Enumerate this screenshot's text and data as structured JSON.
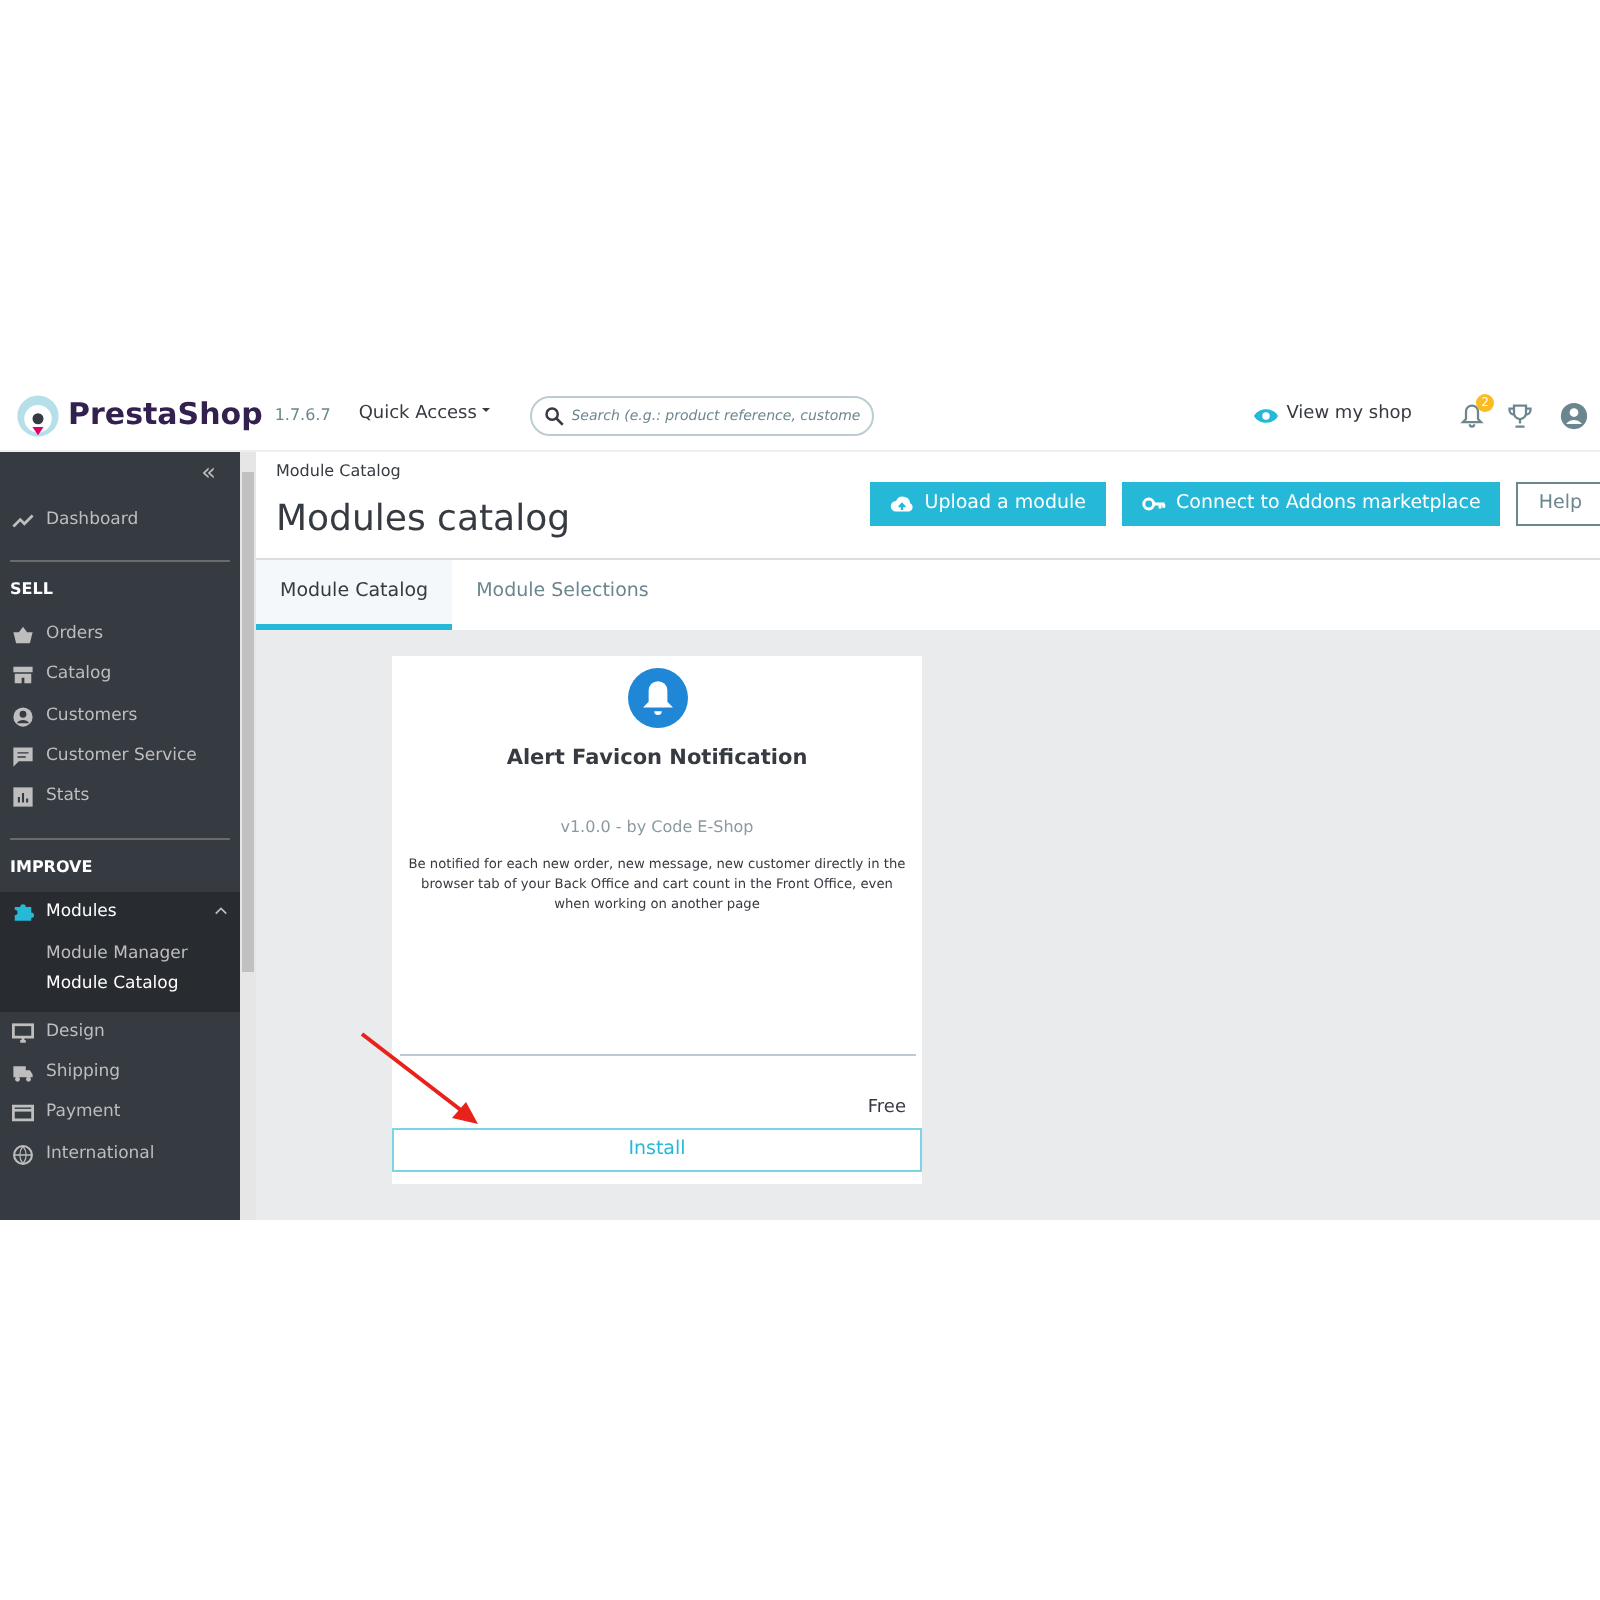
{
  "header": {
    "logo": "PrestaShop",
    "version": "1.7.6.7",
    "quick_access": "Quick Access",
    "search": {
      "placeholder": "Search (e.g.: product reference, custome"
    },
    "view_shop": "View my shop",
    "notifications": "2"
  },
  "sidebar": {
    "collapse": "«",
    "items": [
      {
        "kind": "item",
        "label": "Dashboard",
        "expanded": false
      },
      {
        "kind": "section",
        "label": "SELL"
      },
      {
        "kind": "item",
        "label": "Orders",
        "expanded": false
      },
      {
        "kind": "item",
        "label": "Catalog",
        "expanded": false
      },
      {
        "kind": "item",
        "label": "Customers",
        "expanded": false
      },
      {
        "kind": "item",
        "label": "Customer Service",
        "expanded": false
      },
      {
        "kind": "item",
        "label": "Stats",
        "expanded": false
      },
      {
        "kind": "section",
        "label": "IMPROVE"
      },
      {
        "kind": "item",
        "label": "Modules",
        "expanded": true,
        "children": [
          {
            "label": "Module Manager",
            "selected": false
          },
          {
            "label": "Module Catalog",
            "selected": true
          }
        ]
      },
      {
        "kind": "item",
        "label": "Design",
        "expanded": false
      },
      {
        "kind": "item",
        "label": "Shipping",
        "expanded": false
      },
      {
        "kind": "item",
        "label": "Payment",
        "expanded": false
      },
      {
        "kind": "item",
        "label": "International",
        "expanded": false
      }
    ]
  },
  "page": {
    "breadcrumb": "Module Catalog",
    "title": "Modules catalog",
    "buttons": [
      {
        "label": "Upload a module",
        "kind": "primary"
      },
      {
        "label": "Connect to Addons marketplace",
        "kind": "primary"
      },
      {
        "label": "Help",
        "kind": "outline"
      }
    ]
  },
  "tabs": [
    {
      "label": "Module Catalog",
      "selected": true
    },
    {
      "label": "Module Selections",
      "selected": false
    }
  ],
  "module": {
    "name": "Alert Favicon Notification",
    "meta": "v1.0.0 - by Code E-Shop",
    "description": "Be notified for each new order, new message, new customer directly in the browser tab of your Back Office and cart count in the Front Office, even when working on another page",
    "price": "Free",
    "action": "Install"
  }
}
